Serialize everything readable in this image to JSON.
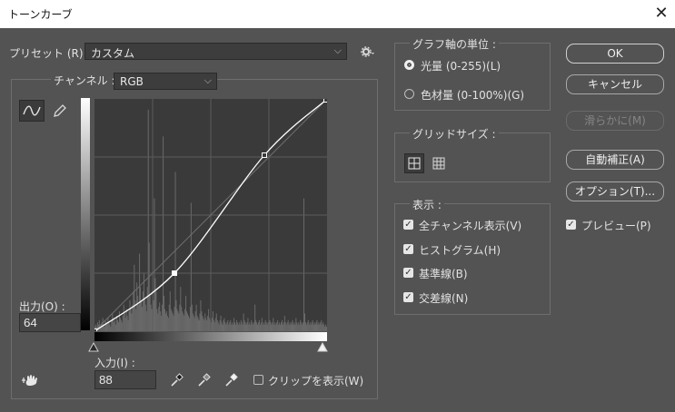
{
  "window": {
    "title": "トーンカーブ",
    "close_glyph": "✕"
  },
  "preset": {
    "label": "プリセット (R) :",
    "value": "カスタム"
  },
  "channel": {
    "label": "チャンネル :",
    "value": "RGB"
  },
  "output": {
    "label": "出力(O) :",
    "value": "64"
  },
  "input": {
    "label": "入力(I) :",
    "value": "88"
  },
  "clip": {
    "label": "クリップを表示(W)",
    "checked": false
  },
  "graph_units": {
    "legend": "グラフ軸の単位 :",
    "options": [
      {
        "label": "光量 (0-255)(L)",
        "selected": true
      },
      {
        "label": "色材量 (0-100%)(G)",
        "selected": false
      }
    ]
  },
  "grid_size": {
    "legend": "グリッドサイズ :"
  },
  "display": {
    "legend": "表示 :",
    "options": [
      {
        "label": "全チャンネル表示(V)",
        "checked": true
      },
      {
        "label": "ヒストグラム(H)",
        "checked": true
      },
      {
        "label": "基準線(B)",
        "checked": true
      },
      {
        "label": "交差線(N)",
        "checked": true
      }
    ]
  },
  "buttons": {
    "ok": "OK",
    "cancel": "キャンセル",
    "smooth": "滑らかに(M)",
    "auto": "自動補正(A)",
    "options": "オプション(T)..."
  },
  "preview": {
    "label": "プレビュー(P)",
    "checked": true
  },
  "curve": {
    "points": [
      [
        0,
        0
      ],
      [
        88,
        64
      ],
      [
        187,
        194
      ],
      [
        255,
        255
      ]
    ],
    "selected_point": [
      88,
      64
    ]
  },
  "histogram": {
    "bins": [
      2,
      3,
      2,
      4,
      3,
      5,
      2,
      3,
      4,
      6,
      3,
      2,
      5,
      4,
      3,
      6,
      4,
      3,
      2,
      5,
      8,
      6,
      4,
      5,
      3,
      7,
      5,
      4,
      9,
      6,
      5,
      4,
      7,
      12,
      8,
      6,
      10,
      7,
      5,
      9,
      14,
      10,
      8,
      12,
      18,
      30,
      14,
      10,
      22,
      16,
      12,
      35,
      20,
      14,
      11,
      18,
      26,
      15,
      12,
      9,
      20,
      100,
      40,
      16,
      12,
      10,
      9,
      14,
      60,
      24,
      18,
      10,
      8,
      11,
      13,
      9,
      7,
      12,
      88,
      16,
      10,
      8,
      9,
      7,
      6,
      12,
      18,
      10,
      9,
      8,
      7,
      11,
      72,
      14,
      10,
      9,
      8,
      12,
      20,
      11,
      9,
      8,
      7,
      10,
      16,
      9,
      8,
      7,
      6,
      11,
      58,
      12,
      8,
      7,
      6,
      9,
      12,
      7,
      6,
      5,
      8,
      14,
      9,
      7,
      6,
      5,
      8,
      6,
      5,
      7,
      10,
      6,
      5,
      4,
      6,
      9,
      5,
      4,
      6,
      8,
      5,
      4,
      3,
      5,
      7,
      4,
      3,
      5,
      6,
      4,
      3,
      4,
      5,
      3,
      4,
      5,
      3,
      4,
      3,
      6,
      4,
      3,
      5,
      4,
      3,
      4,
      3,
      5,
      4,
      3,
      8,
      5,
      4,
      3,
      4,
      6,
      3,
      4,
      3,
      5,
      4,
      3,
      4,
      12,
      5,
      4,
      3,
      4,
      5,
      3,
      4,
      6,
      3,
      4,
      3,
      5,
      4,
      3,
      4,
      3,
      5,
      4,
      3,
      4,
      6,
      3,
      4,
      3,
      4,
      5,
      3,
      4,
      3,
      4,
      5,
      3,
      4,
      7,
      4,
      3,
      4,
      5,
      3,
      4,
      3,
      4,
      5,
      3,
      4,
      3,
      6,
      4,
      3,
      4,
      3,
      5,
      4,
      3,
      4,
      60,
      8,
      4,
      3,
      4,
      5,
      3,
      4,
      3,
      4,
      5,
      3,
      4,
      3,
      4,
      5,
      3,
      4,
      3,
      4,
      5,
      3,
      4,
      3,
      2,
      3,
      2
    ]
  }
}
